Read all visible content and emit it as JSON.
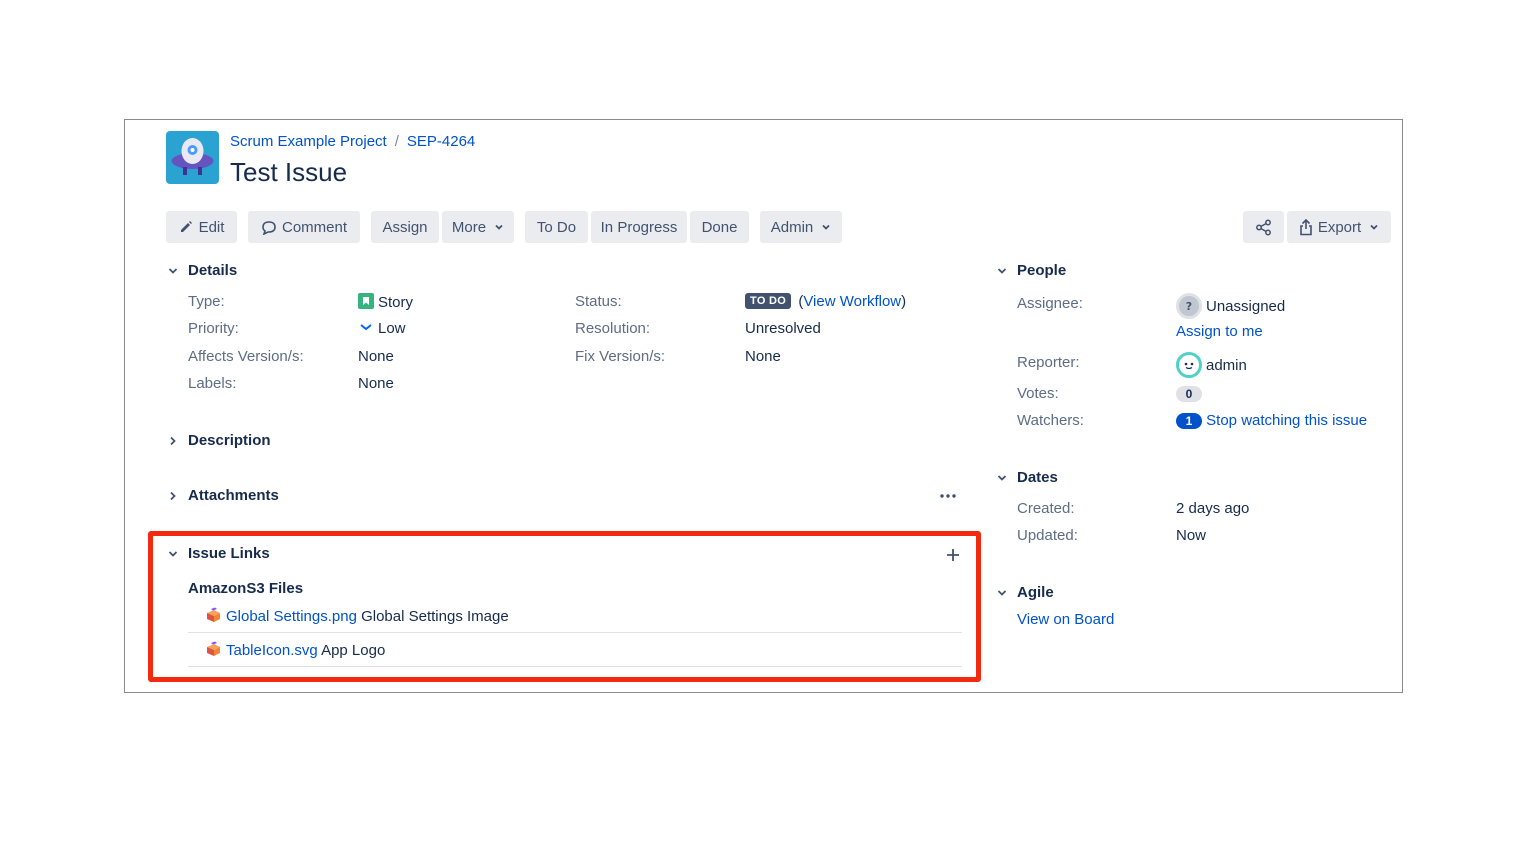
{
  "breadcrumb": {
    "project": "Scrum Example Project",
    "separator": "/",
    "issue_key": "SEP-4264"
  },
  "issue": {
    "title": "Test Issue"
  },
  "toolbar": {
    "edit": "Edit",
    "comment": "Comment",
    "assign": "Assign",
    "more": "More",
    "todo": "To Do",
    "in_progress": "In Progress",
    "done": "Done",
    "admin": "Admin",
    "export": "Export"
  },
  "details": {
    "heading": "Details",
    "type_label": "Type:",
    "type_value": "Story",
    "priority_label": "Priority:",
    "priority_value": "Low",
    "affects_label": "Affects Version/s:",
    "affects_value": "None",
    "labels_label": "Labels:",
    "labels_value": "None",
    "status_label": "Status:",
    "status_value": "TO DO",
    "view_workflow": "View Workflow",
    "resolution_label": "Resolution:",
    "resolution_value": "Unresolved",
    "fix_label": "Fix Version/s:",
    "fix_value": "None"
  },
  "description": {
    "heading": "Description"
  },
  "attachments": {
    "heading": "Attachments"
  },
  "issue_links": {
    "heading": "Issue Links",
    "group": "AmazonS3 Files",
    "items": [
      {
        "file": "Global Settings.png",
        "desc": "Global Settings Image"
      },
      {
        "file": "TableIcon.svg",
        "desc": "App Logo"
      }
    ]
  },
  "people": {
    "heading": "People",
    "assignee_label": "Assignee:",
    "assignee_value": "Unassigned",
    "assign_to_me": "Assign to me",
    "reporter_label": "Reporter:",
    "reporter_value": "admin",
    "votes_label": "Votes:",
    "votes_value": "0",
    "watchers_label": "Watchers:",
    "watchers_count": "1",
    "stop_watching": "Stop watching this issue"
  },
  "dates": {
    "heading": "Dates",
    "created_label": "Created:",
    "created_value": "2 days ago",
    "updated_label": "Updated:",
    "updated_value": "Now"
  },
  "agile": {
    "heading": "Agile",
    "view_on_board": "View on Board"
  },
  "colors": {
    "link": "#0052cc",
    "highlight": "#f22a0f",
    "story": "#36b37e",
    "lozenge": "#42526e"
  }
}
